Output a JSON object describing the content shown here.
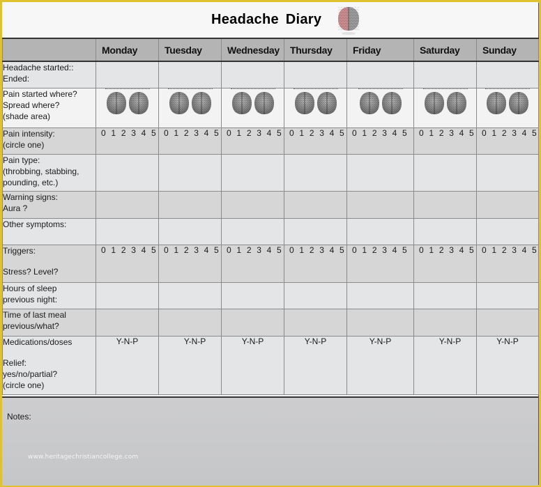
{
  "header": {
    "title": "Headache Diary",
    "title_icon": "brain-icon"
  },
  "days": [
    "Monday",
    "Tuesday",
    "Wednesday",
    "Thursday",
    "Friday",
    "Saturday",
    "Sunday"
  ],
  "rows": {
    "headache_started": {
      "label_1": "Headache started::",
      "label_2": "Ended:"
    },
    "pain_location": {
      "label_1": "Pain started where?",
      "label_2": "Spread where?",
      "label_3": "(shade area)",
      "icon": "brain-diagram-icon"
    },
    "pain_intensity": {
      "label_1": "Pain intensity:",
      "label_2": "(circle one)",
      "scales": [
        "0 1 2 3 4 5",
        "0 1 2 3 4 5",
        "0 1 2 3 4 5",
        "0 1 2 3 4 5",
        "0 1 2 3 4 5",
        "0 1 2 3 4 5",
        "0 1 2 3 4 5"
      ]
    },
    "pain_type": {
      "label_1": "Pain type:",
      "label_2": "(throbbing,  stabbing,",
      "label_3": "pounding,  etc.)"
    },
    "warning_signs": {
      "label_1": "Warning signs:",
      "label_2": "Aura ?"
    },
    "other_symptoms": {
      "label_1": "Other symptoms:"
    },
    "triggers": {
      "label_1": "Triggers:",
      "label_2": "Stress? Level?",
      "scales": [
        " 0 1 2 3 4 5",
        "0 1 2 3 4 5",
        "0 1 2 3 4 5",
        " 0 1 2 3 4 5",
        "0  1 2 3 4 5",
        "0 1 2 3 4 5",
        "0 1 2 3 4 5"
      ]
    },
    "sleep": {
      "label_1": "Hours of sleep",
      "label_2": "previous night:"
    },
    "last_meal": {
      "label_1": "Time of last meal",
      "label_2": "previous/what?"
    },
    "medications": {
      "label_1": "Medications/doses",
      "label_2": "Relief:",
      "label_3": "yes/no/partial?",
      "label_4": "(circle one)",
      "options": [
        "Y-N-P",
        "Y-N-P",
        "Y-N-P",
        "Y-N-P",
        "Y-N-P",
        "Y-N-P",
        "Y-N-P"
      ]
    }
  },
  "notes": {
    "label": "Notes:"
  },
  "watermark": "www.heritagechristiancollege.com",
  "colors": {
    "frame": "#e0c22e",
    "header_row": "#b4b4b4",
    "row_dark": "#d6d6d7",
    "row_light": "#e4e5e6",
    "notes_bg": "#c8c9cb"
  }
}
